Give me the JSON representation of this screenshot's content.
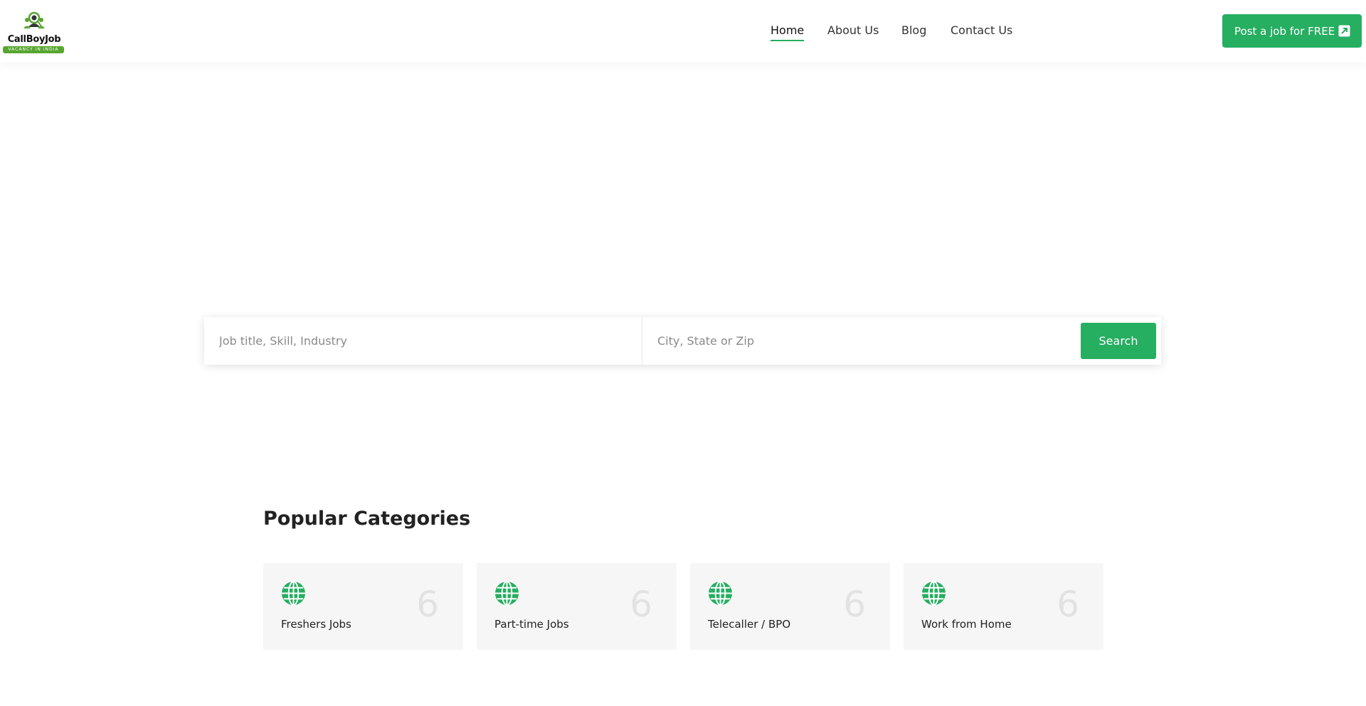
{
  "brand": {
    "name": "CallBoyJob",
    "tagline": "VACANCY IN INDIA",
    "accent": "#26ae61",
    "logo_green": "#57a630"
  },
  "nav": {
    "items": [
      {
        "label": "Home",
        "active": true
      },
      {
        "label": "About Us",
        "active": false
      },
      {
        "label": "Blog",
        "active": false
      },
      {
        "label": "Contact Us",
        "active": false
      }
    ]
  },
  "header": {
    "post_job_label": "Post a job for FREE",
    "post_job_icon": "external-link-icon"
  },
  "search": {
    "keyword_placeholder": "Job title, Skill, Industry",
    "location_placeholder": "City, State or Zip",
    "button_label": "Search"
  },
  "categories": {
    "title": "Popular Categories",
    "items": [
      {
        "label": "Freshers Jobs",
        "count": "6",
        "icon": "globe-icon"
      },
      {
        "label": "Part-time Jobs",
        "count": "6",
        "icon": "globe-icon"
      },
      {
        "label": "Telecaller / BPO",
        "count": "6",
        "icon": "globe-icon"
      },
      {
        "label": "Work from Home",
        "count": "6",
        "icon": "globe-icon"
      }
    ]
  }
}
